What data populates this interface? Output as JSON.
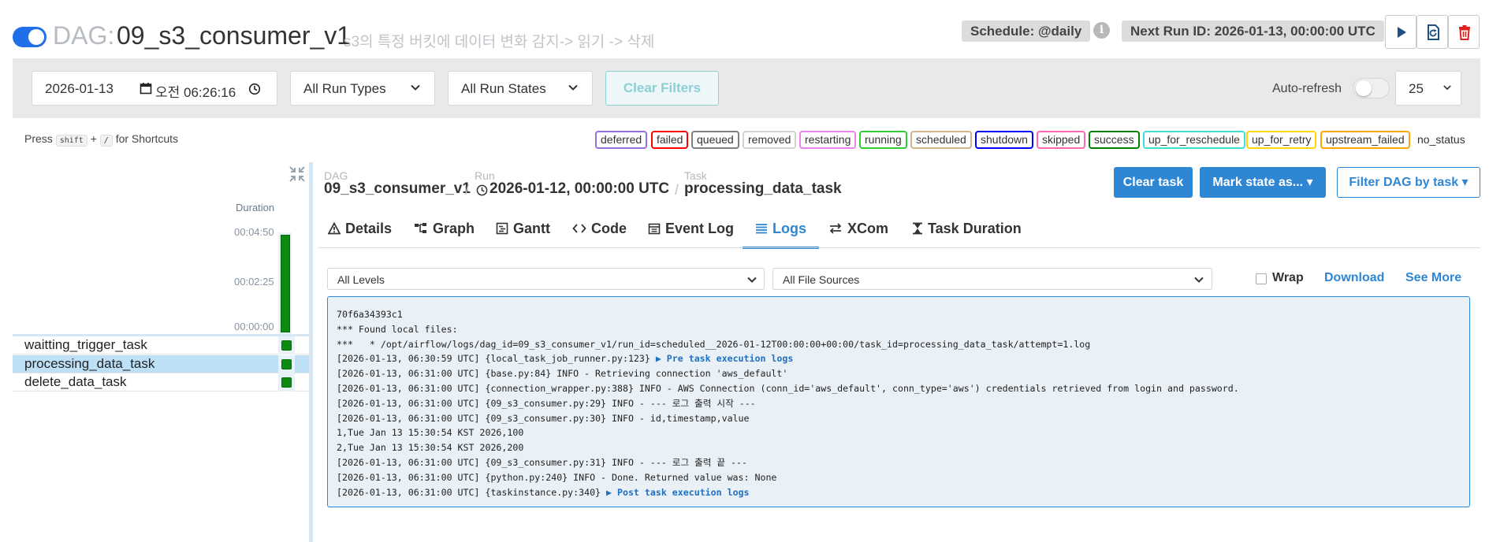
{
  "header": {
    "dag_prefix": "DAG:",
    "dag_name": "09_s3_consumer_v1",
    "description": "s3의 특정 버킷에 데이터 변화 감지-> 읽기 -> 삭제",
    "schedule": "Schedule: @daily",
    "next_run": "Next Run ID: 2026-01-13, 00:00:00 UTC"
  },
  "filters": {
    "date": "2026-01-13",
    "time": "오전  06:26:16",
    "run_types": "All Run Types",
    "run_states": "All Run States",
    "clear_filters": "Clear Filters",
    "auto_refresh": "Auto-refresh",
    "page_size": "25"
  },
  "shortcut": {
    "press": "Press",
    "key1": "shift",
    "plus": "+",
    "key2": "/",
    "suffix": "for Shortcuts"
  },
  "legend": [
    {
      "label": "deferred",
      "color": "#9370db"
    },
    {
      "label": "failed",
      "color": "#ff0000"
    },
    {
      "label": "queued",
      "color": "#808080"
    },
    {
      "label": "removed",
      "color": "#d3d3d3"
    },
    {
      "label": "restarting",
      "color": "#ee82ee"
    },
    {
      "label": "running",
      "color": "#32cd32"
    },
    {
      "label": "scheduled",
      "color": "#d2b48c"
    },
    {
      "label": "shutdown",
      "color": "#0000ff"
    },
    {
      "label": "skipped",
      "color": "#ff69b4"
    },
    {
      "label": "success",
      "color": "#008000"
    },
    {
      "label": "up_for_reschedule",
      "color": "#40e0d0"
    },
    {
      "label": "up_for_retry",
      "color": "#ffd700"
    },
    {
      "label": "upstream_failed",
      "color": "#ffa500"
    },
    {
      "label": "no_status",
      "color": ""
    }
  ],
  "grid": {
    "duration_title": "Duration",
    "ticks": [
      "00:04:50",
      "00:02:25",
      "00:00:00"
    ],
    "run_duration_fraction": 1.0,
    "tasks": [
      {
        "label": "waitting_trigger_task",
        "state": "success",
        "selected": false
      },
      {
        "label": "processing_data_task",
        "state": "success",
        "selected": true
      },
      {
        "label": "delete_data_task",
        "state": "success",
        "selected": false
      }
    ]
  },
  "breadcrumb": {
    "dag_label": "DAG",
    "dag_value": "09_s3_consumer_v1",
    "run_label": "Run",
    "run_value": "2026-01-12, 00:00:00 UTC",
    "task_label": "Task",
    "task_value": "processing_data_task",
    "sep": "/"
  },
  "actions": {
    "clear_task": "Clear task",
    "mark_state": "Mark state as... ▾",
    "filter_dag": "Filter DAG by task ▾"
  },
  "tabs": [
    {
      "label": "Details",
      "icon": "warning-icon"
    },
    {
      "label": "Graph",
      "icon": "graph-icon"
    },
    {
      "label": "Gantt",
      "icon": "gantt-icon"
    },
    {
      "label": "Code",
      "icon": "code-icon"
    },
    {
      "label": "Event Log",
      "icon": "calendar-icon"
    },
    {
      "label": "Logs",
      "icon": "list-icon",
      "active": true
    },
    {
      "label": "XCom",
      "icon": "swap-icon"
    },
    {
      "label": "Task Duration",
      "icon": "hourglass-icon"
    }
  ],
  "logs": {
    "levels": "All Levels",
    "sources": "All File Sources",
    "wrap": "Wrap",
    "download": "Download",
    "see_more": "See More",
    "lines": [
      {
        "text": "70f6a34393c1"
      },
      {
        "text": "*** Found local files:"
      },
      {
        "text": "***   * /opt/airflow/logs/dag_id=09_s3_consumer_v1/run_id=scheduled__2026-01-12T00:00:00+00:00/task_id=processing_data_task/attempt=1.log"
      },
      {
        "text": "[2026-01-13, 06:30:59 UTC] {local_task_job_runner.py:123} ",
        "link": "▶ Pre task execution logs"
      },
      {
        "text": "[2026-01-13, 06:31:00 UTC] {base.py:84} INFO - Retrieving connection 'aws_default'"
      },
      {
        "text": "[2026-01-13, 06:31:00 UTC] {connection_wrapper.py:388} INFO - AWS Connection (conn_id='aws_default', conn_type='aws') credentials retrieved from login and password."
      },
      {
        "text": "[2026-01-13, 06:31:00 UTC] {09_s3_consumer.py:29} INFO - --- 로그 출력 시작 ---"
      },
      {
        "text": "[2026-01-13, 06:31:00 UTC] {09_s3_consumer.py:30} INFO - id,timestamp,value"
      },
      {
        "text": "1,Tue Jan 13 15:30:54 KST 2026,100"
      },
      {
        "text": "2,Tue Jan 13 15:30:54 KST 2026,200"
      },
      {
        "text": "[2026-01-13, 06:31:00 UTC] {09_s3_consumer.py:31} INFO - --- 로그 출력 끝 ---"
      },
      {
        "text": "[2026-01-13, 06:31:00 UTC] {python.py:240} INFO - Done. Returned value was: None"
      },
      {
        "text": "[2026-01-13, 06:31:00 UTC] {taskinstance.py:340} ",
        "link": "▶ Post task execution logs"
      }
    ]
  }
}
